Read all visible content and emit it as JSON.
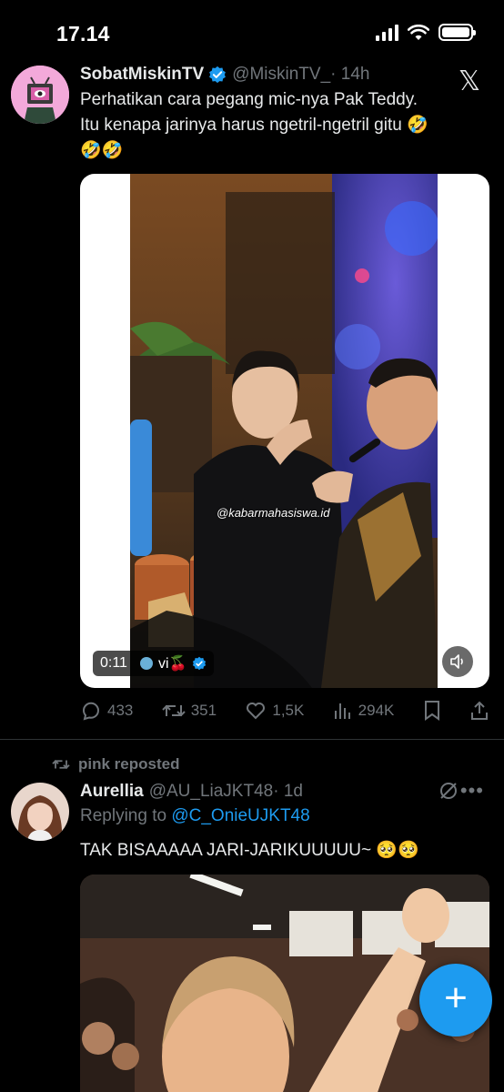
{
  "status_bar": {
    "time": "17.14"
  },
  "tweet1": {
    "name": "SobatMiskinTV",
    "handle": "@MiskinTV_",
    "time": "· 14h",
    "text_line1": "Perhatikan cara pegang mic-nya Pak Teddy.",
    "text_line2": "Itu kenapa jarinya harus ngetril-ngetril gitu 🤣",
    "text_line3": "🤣🤣",
    "video": {
      "watermark": "@kabarmahasiswa.id",
      "duration": "0:11",
      "source_label": "vi🍒"
    },
    "stats": {
      "replies": "433",
      "reposts": "351",
      "likes": "1,5K",
      "views": "294K"
    }
  },
  "tweet2": {
    "repost_label": "pink reposted",
    "name": "Aurellia",
    "handle": "@AU_LiaJKT48",
    "time": "· 1d",
    "replying_prefix": "Replying to",
    "replying_handle": "@C_OnieUJKT48",
    "text": "TAK BISAAAAA JARI-JARIKUUUUU~ 🥺🥺"
  },
  "fab": {
    "label": "+"
  },
  "colors": {
    "accent": "#1d9bf0",
    "muted": "#71767b",
    "text": "#e7e9ea",
    "background": "#000000"
  }
}
